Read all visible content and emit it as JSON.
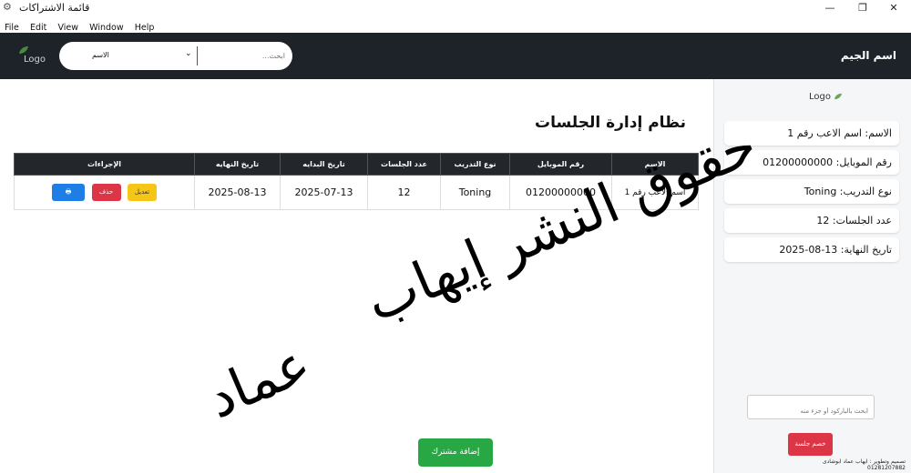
{
  "window": {
    "title": "قائمة الاشتراكات",
    "controls": {
      "minimize": "—",
      "maximize": "❐",
      "close": "✕"
    }
  },
  "menu": [
    "File",
    "Edit",
    "View",
    "Window",
    "Help"
  ],
  "header": {
    "logo_text": "Logo",
    "search_select_value": "الاسم",
    "search_placeholder": "ابحث...",
    "gym_name": "اسم الجيم"
  },
  "main": {
    "title": "نظام إدارة الجلسات",
    "table": {
      "columns": [
        "الاسم",
        "رقم الموبايل",
        "نوع التدريب",
        "عدد الجلسات",
        "تاريخ البدايه",
        "تاريخ النهايه",
        "الإجراءات"
      ],
      "rows": [
        {
          "name": "اسم الاعب رقم 1",
          "mobile": "01200000000",
          "training": "Toning",
          "sessions": "12",
          "start": "2025-07-13",
          "end": "2025-08-13"
        }
      ],
      "actions": {
        "edit": "تعديل",
        "delete": "حذف",
        "print": "🖶"
      }
    },
    "add_button": "إضافة مشترك"
  },
  "sidebar": {
    "logo_text": "Logo",
    "cards": [
      "الاسم: اسم الاعب رقم 1",
      "رقم الموبايل: 01200000000",
      "نوع التدريب: Toning",
      "عدد الجلسات: 12",
      "تاريخ النهاية: 13-08-2025"
    ],
    "barcode_placeholder": "ابحث بالباركود أو جزء منه",
    "discount_button": "خصم جلسة",
    "credit_line1": "تصميم وتطوير : ايهاب عماد ابوشادى",
    "credit_line2": "01281207882"
  },
  "watermark": {
    "line1": "حقوق النشر إيهاب",
    "line2": "عماد"
  },
  "colors": {
    "header_bg": "#1e2329",
    "table_header_bg": "#23272b",
    "edit": "#f5c518",
    "delete": "#dc3545",
    "print": "#1e7ee6",
    "add": "#28a745"
  }
}
